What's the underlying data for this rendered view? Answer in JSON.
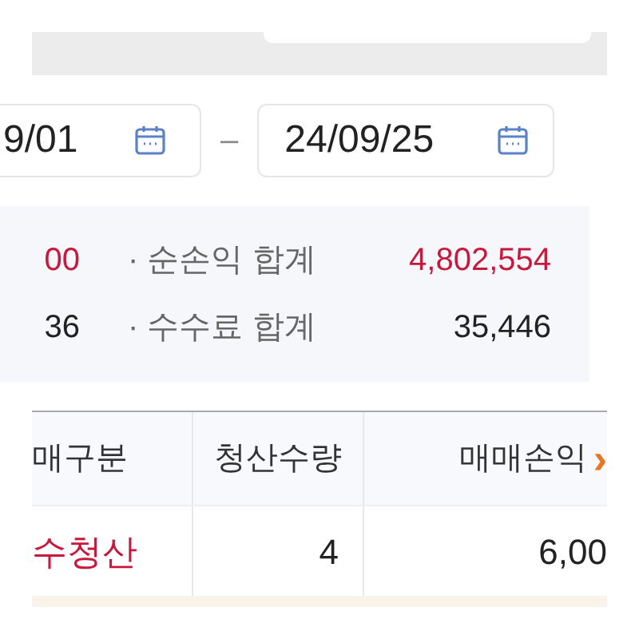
{
  "date_range": {
    "start": "9/01",
    "separator": "–",
    "end": "24/09/25"
  },
  "summary": [
    {
      "left": {
        "text": "00",
        "color": "#c8193c"
      },
      "label": "· 순손익 합계",
      "value": "4,802,554",
      "color": "#c8193c"
    },
    {
      "left": {
        "text": "36",
        "color": "#222222"
      },
      "label": "· 수수료 합계",
      "value": "35,446",
      "color": "#222222"
    }
  ],
  "table": {
    "columns": [
      "매구분",
      "청산수량",
      "매매손익"
    ],
    "more": "›",
    "rows": [
      {
        "cells": [
          "수청산",
          "4",
          "6,00"
        ],
        "color": "#c8193c"
      }
    ]
  }
}
